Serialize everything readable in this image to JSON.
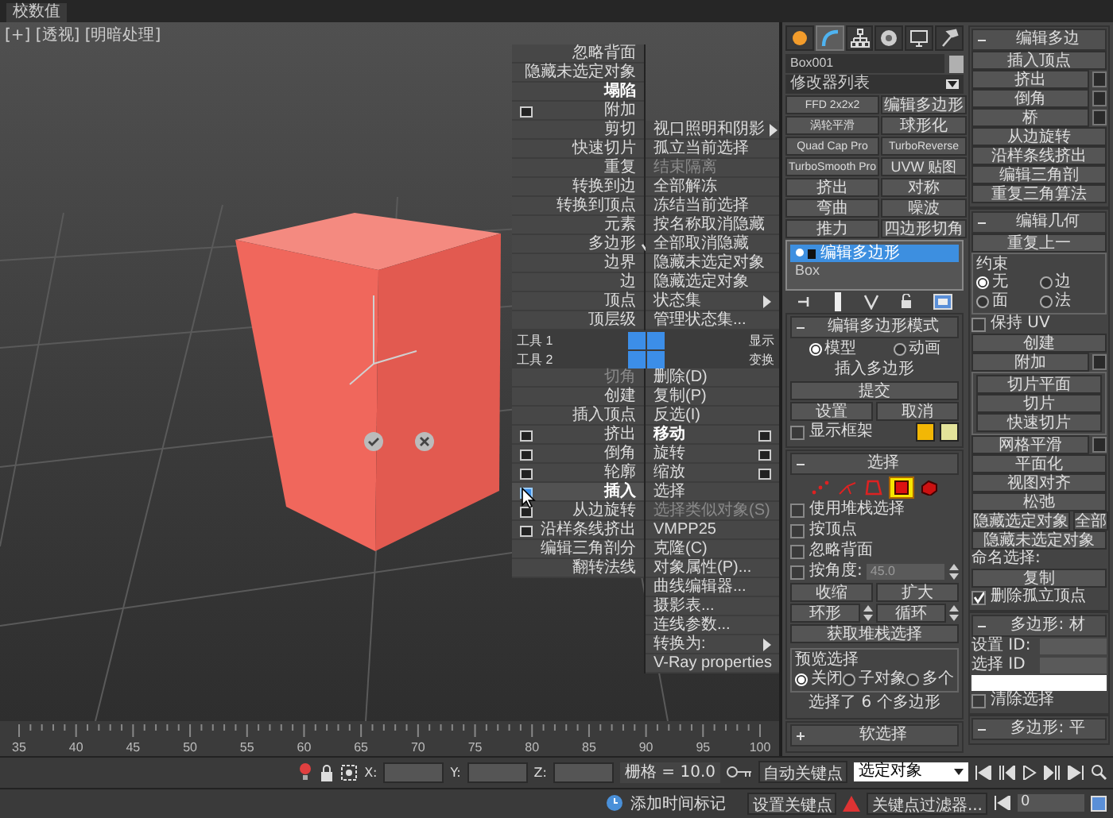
{
  "tab": "校数值",
  "viewport": {
    "label": "[+] [透视] [明暗处理]"
  },
  "quad_menu": {
    "top_left": {
      "items": [
        {
          "label": "忽略背面",
          "kind": "plain"
        },
        {
          "label": "隐藏未选定对象",
          "kind": "plain"
        },
        {
          "label": "塌陷",
          "kind": "strong"
        },
        {
          "label": "附加",
          "kind": "option"
        },
        {
          "label": "剪切",
          "kind": "plain"
        },
        {
          "label": "快速切片",
          "kind": "plain"
        },
        {
          "label": "重复",
          "kind": "plain"
        },
        {
          "label": "转换到边",
          "kind": "plain"
        },
        {
          "label": "转换到顶点",
          "kind": "plain"
        },
        {
          "label": "元素",
          "kind": "plain"
        },
        {
          "label": "多边形",
          "kind": "checked"
        },
        {
          "label": "边界",
          "kind": "plain"
        },
        {
          "label": "边",
          "kind": "plain"
        },
        {
          "label": "顶点",
          "kind": "plain"
        },
        {
          "label": "顶层级",
          "kind": "plain"
        }
      ]
    },
    "top_right": {
      "items": [
        {
          "label": "视口照明和阴影",
          "kind": "submenu"
        },
        {
          "label": "孤立当前选择",
          "kind": "plain"
        },
        {
          "label": "结束隔离",
          "kind": "disabled"
        },
        {
          "label": "全部解冻",
          "kind": "plain"
        },
        {
          "label": "冻结当前选择",
          "kind": "plain"
        },
        {
          "label": "按名称取消隐藏",
          "kind": "plain"
        },
        {
          "label": "全部取消隐藏",
          "kind": "plain"
        },
        {
          "label": "隐藏未选定对象",
          "kind": "plain"
        },
        {
          "label": "隐藏选定对象",
          "kind": "plain"
        },
        {
          "label": "状态集",
          "kind": "submenu"
        },
        {
          "label": "管理状态集...",
          "kind": "plain"
        }
      ]
    },
    "band_1": {
      "left": "工具 1",
      "right": "显示"
    },
    "band_2": {
      "left": "工具 2",
      "right": "变换"
    },
    "bottom_left": {
      "items": [
        {
          "label": "切角",
          "kind": "disabled"
        },
        {
          "label": "创建",
          "kind": "plain"
        },
        {
          "label": "插入顶点",
          "kind": "plain"
        },
        {
          "label": "挤出",
          "kind": "option"
        },
        {
          "label": "倒角",
          "kind": "option"
        },
        {
          "label": "轮廓",
          "kind": "option"
        },
        {
          "label": "插入",
          "kind": "hover"
        },
        {
          "label": "从边旋转",
          "kind": "option"
        },
        {
          "label": "沿样条线挤出",
          "kind": "option"
        },
        {
          "label": "编辑三角剖分",
          "kind": "plain"
        },
        {
          "label": "翻转法线",
          "kind": "plain"
        }
      ]
    },
    "bottom_right": {
      "items": [
        {
          "label": "删除(D)",
          "kind": "plain"
        },
        {
          "label": "复制(P)",
          "kind": "plain"
        },
        {
          "label": "反选(I)",
          "kind": "plain"
        },
        {
          "label": "移动",
          "kind": "strong"
        },
        {
          "label": "旋转",
          "kind": "option"
        },
        {
          "label": "缩放",
          "kind": "option"
        },
        {
          "label": "选择",
          "kind": "plain"
        },
        {
          "label": "选择类似对象(S)",
          "kind": "disabled"
        },
        {
          "label": "VMPP25",
          "kind": "plain"
        },
        {
          "label": "克隆(C)",
          "kind": "plain"
        },
        {
          "label": "对象属性(P)...",
          "kind": "plain"
        },
        {
          "label": "曲线编辑器...",
          "kind": "plain"
        },
        {
          "label": "摄影表...",
          "kind": "plain"
        },
        {
          "label": "连线参数...",
          "kind": "plain"
        },
        {
          "label": "转换为:",
          "kind": "submenu"
        },
        {
          "label": "V-Ray properties",
          "kind": "plain"
        }
      ]
    }
  },
  "command_panel": {
    "tabs": [
      {
        "kind": "create",
        "selected": false
      },
      {
        "kind": "modify",
        "selected": true
      },
      {
        "kind": "hierarchy",
        "selected": false
      },
      {
        "kind": "motion",
        "selected": false
      },
      {
        "kind": "display",
        "selected": false
      },
      {
        "kind": "utilities",
        "selected": false
      }
    ],
    "object_name": "Box001",
    "modifier_list": "修改器列表",
    "modifier_buttons": [
      "FFD 2x2x2",
      "编辑多边形",
      "涡轮平滑",
      "球形化",
      "Quad Cap Pro",
      "TurboReverse",
      "TurboSmooth Pro",
      "UVW 贴图",
      "挤出",
      "对称",
      "弯曲",
      "噪波",
      "推力",
      "四边形切角"
    ],
    "stack": [
      {
        "label": "编辑多边形",
        "selected": true
      },
      {
        "label": "Box",
        "selected": false
      }
    ],
    "columns": [
      {
        "rollouts": [
          {
            "title": "编辑多边形模式",
            "expanded": true,
            "rows": [
              {
                "kind": "radios",
                "items": [
                  {
                    "label": "模型",
                    "selected": true
                  },
                  {
                    "label": "动画",
                    "selected": false
                  }
                ]
              },
              {
                "kind": "text",
                "text": "插入多边形"
              },
              {
                "kind": "buttons",
                "items": [
                  {
                    "label": "提交",
                    "kind": "plain"
                  }
                ]
              },
              {
                "kind": "buttons",
                "items": [
                  {
                    "label": "设置",
                    "kind": "plain"
                  },
                  {
                    "label": "取消",
                    "kind": "plain"
                  }
                ]
              },
              {
                "kind": "check",
                "label": "显示框架",
                "checked": false,
                "swatches": [
                  {
                    "color": "#f2b705"
                  },
                  {
                    "color": "#e3e39a"
                  }
                ]
              }
            ]
          },
          {
            "title": "选择",
            "expanded": true,
            "rows": [
              {
                "kind": "subobjects",
                "items": [
                  {
                    "kind": "vertex",
                    "selected": false
                  },
                  {
                    "kind": "edge",
                    "selected": false
                  },
                  {
                    "kind": "border",
                    "selected": false
                  },
                  {
                    "kind": "polygon",
                    "selected": true
                  },
                  {
                    "kind": "element",
                    "selected": false
                  }
                ]
              },
              {
                "kind": "check",
                "label": "使用堆栈选择",
                "checked": false
              },
              {
                "kind": "check",
                "label": "按顶点",
                "checked": false
              },
              {
                "kind": "check",
                "label": "忽略背面",
                "checked": false
              },
              {
                "kind": "check",
                "label": "按角度:",
                "checked": false,
                "value": "45.0"
              },
              {
                "kind": "buttons",
                "items": [
                  {
                    "label": "收缩",
                    "kind": "plain"
                  },
                  {
                    "label": "扩大",
                    "kind": "plain"
                  }
                ]
              },
              {
                "kind": "buttons",
                "items": [
                  {
                    "label": "环形",
                    "kind": "spinner"
                  },
                  {
                    "label": "循环",
                    "kind": "spinner"
                  }
                ]
              },
              {
                "kind": "buttons",
                "items": [
                  {
                    "label": "获取堆栈选择",
                    "kind": "plain"
                  }
                ]
              },
              {
                "kind": "group",
                "title": "预览选择",
                "rows": [
                  {
                    "kind": "radios",
                    "items": [
                      {
                        "label": "关闭",
                        "selected": true
                      },
                      {
                        "label": "子对象",
                        "selected": false
                      },
                      {
                        "label": "多个",
                        "selected": false
                      }
                    ]
                  }
                ]
              },
              {
                "kind": "text",
                "text": "选择了 6 个多边形"
              }
            ]
          },
          {
            "title": "软选择",
            "expanded": false
          }
        ]
      },
      {
        "rollouts": [
          {
            "title": "编辑多边",
            "expanded": true,
            "rows": [
              {
                "kind": "buttons",
                "items": [
                  {
                    "label": "插入顶点",
                    "kind": "plain"
                  }
                ]
              },
              {
                "kind": "buttons",
                "items": [
                  {
                    "label": "挤出",
                    "kind": "option"
                  }
                ]
              },
              {
                "kind": "buttons",
                "items": [
                  {
                    "label": "倒角",
                    "kind": "option"
                  }
                ]
              },
              {
                "kind": "buttons",
                "items": [
                  {
                    "label": "桥",
                    "kind": "option"
                  }
                ]
              },
              {
                "kind": "buttons",
                "items": [
                  {
                    "label": "从边旋转",
                    "kind": "plain"
                  }
                ]
              },
              {
                "kind": "buttons",
                "items": [
                  {
                    "label": "沿样条线挤出",
                    "kind": "plain"
                  }
                ]
              },
              {
                "kind": "buttons",
                "items": [
                  {
                    "label": "编辑三角剖",
                    "kind": "plain"
                  }
                ]
              },
              {
                "kind": "buttons",
                "items": [
                  {
                    "label": "重复三角算法",
                    "kind": "plain"
                  }
                ]
              }
            ]
          },
          {
            "title": "编辑几何",
            "expanded": true,
            "rows": [
              {
                "kind": "buttons",
                "items": [
                  {
                    "label": "重复上一",
                    "kind": "plain"
                  }
                ]
              },
              {
                "kind": "group",
                "title": "约束",
                "rows": [
                  {
                    "kind": "radios",
                    "items": [
                      {
                        "label": "无",
                        "selected": true
                      },
                      {
                        "label": "边",
                        "selected": false
                      },
                      {
                        "label": "面",
                        "selected": false
                      },
                      {
                        "label": "法",
                        "selected": false
                      }
                    ]
                  }
                ]
              },
              {
                "kind": "check",
                "label": "保持 UV",
                "checked": false
              },
              {
                "kind": "buttons",
                "items": [
                  {
                    "label": "创建",
                    "kind": "plain"
                  }
                ]
              },
              {
                "kind": "buttons",
                "items": [
                  {
                    "label": "附加",
                    "kind": "option"
                  }
                ]
              },
              {
                "kind": "group",
                "title": "",
                "rows": [
                  {
                    "kind": "buttons",
                    "items": [
                      {
                        "label": "切片平面"
                      }
                    ]
                  },
                  {
                    "kind": "buttons",
                    "items": [
                      {
                        "label": "切片"
                      }
                    ]
                  },
                  {
                    "kind": "buttons",
                    "items": [
                      {
                        "label": "快速切片"
                      }
                    ]
                  }
                ]
              },
              {
                "kind": "buttons",
                "items": [
                  {
                    "label": "网格平滑",
                    "kind": "option"
                  }
                ]
              },
              {
                "kind": "buttons",
                "items": [
                  {
                    "label": "平面化",
                    "kind": "plain"
                  }
                ]
              },
              {
                "kind": "buttons",
                "items": [
                  {
                    "label": "视图对齐",
                    "kind": "plain"
                  }
                ]
              },
              {
                "kind": "buttons",
                "items": [
                  {
                    "label": "松弛",
                    "kind": "plain"
                  }
                ]
              },
              {
                "kind": "buttons",
                "items": [
                  {
                    "label": "隐藏选定对象",
                    "kind": "plain"
                  },
                  {
                    "label": "全部",
                    "kind": "plain"
                  }
                ]
              },
              {
                "kind": "buttons",
                "items": [
                  {
                    "label": "隐藏未选定对象",
                    "kind": "plain"
                  }
                ]
              },
              {
                "kind": "text",
                "text": "命名选择:"
              },
              {
                "kind": "buttons",
                "items": [
                  {
                    "label": "复制",
                    "kind": "plain"
                  }
                ]
              },
              {
                "kind": "check",
                "label": "删除孤立顶点",
                "checked": true
              }
            ]
          },
          {
            "title": "多边形: 材",
            "expanded": true,
            "rows": [
              {
                "kind": "field",
                "label": "设置 ID:"
              },
              {
                "kind": "field",
                "label": "选择 ID"
              },
              {
                "kind": "whitebox"
              },
              {
                "kind": "check",
                "label": "清除选择",
                "checked": false
              }
            ]
          },
          {
            "title": "多边形: 平",
            "expanded": true
          }
        ]
      }
    ]
  },
  "timeline": {
    "frames": [
      "35",
      "40",
      "45",
      "50",
      "55",
      "60",
      "65",
      "70",
      "75",
      "80",
      "85",
      "90",
      "95",
      "100"
    ]
  },
  "status_bar": {
    "x_label": "X:",
    "y_label": "Y:",
    "z_label": "Z:",
    "grid": "栅格 = 10.0",
    "auto_key": "自动关键点",
    "key_mode": "选定对象",
    "time_tag": "添加时间标记",
    "set_key": "设置关键点",
    "key_filters": "关键点过滤器...",
    "frame": "0"
  }
}
